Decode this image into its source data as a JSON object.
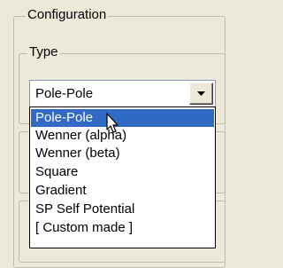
{
  "config_group": {
    "title": "Configuration"
  },
  "type_group": {
    "title": "Type"
  },
  "type_combo": {
    "value": "Pole-Pole",
    "icon": "chevron-down-icon"
  },
  "type_options": [
    {
      "label": "Pole-Pole",
      "selected": true
    },
    {
      "label": "Wenner (alpha)",
      "selected": false
    },
    {
      "label": "Wenner (beta)",
      "selected": false
    },
    {
      "label": "Square",
      "selected": false
    },
    {
      "label": "Gradient",
      "selected": false
    },
    {
      "label": "SP Self Potential",
      "selected": false
    },
    {
      "label": "[ Custom made ]",
      "selected": false
    }
  ],
  "colors": {
    "window": "#ece9d8",
    "selection": "#316ac5",
    "border": "#7f9db9"
  },
  "cursor": {
    "icon": "mouse-pointer-icon"
  }
}
